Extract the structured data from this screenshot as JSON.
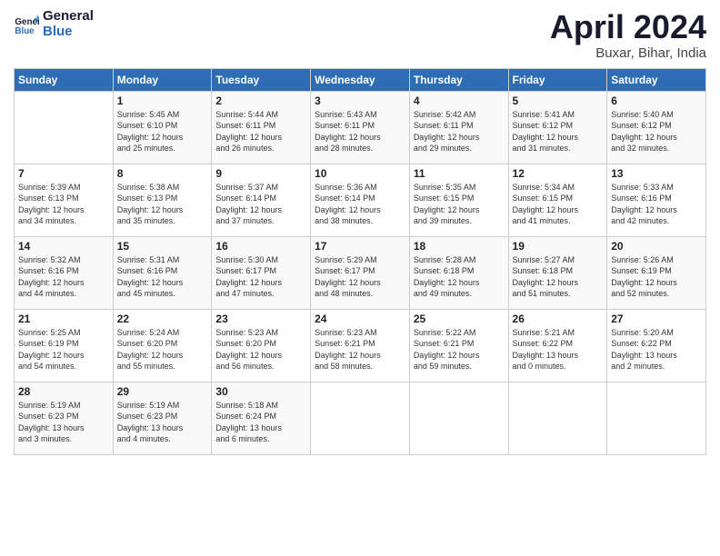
{
  "header": {
    "logo_line1": "General",
    "logo_line2": "Blue",
    "month": "April 2024",
    "location": "Buxar, Bihar, India"
  },
  "days_of_week": [
    "Sunday",
    "Monday",
    "Tuesday",
    "Wednesday",
    "Thursday",
    "Friday",
    "Saturday"
  ],
  "weeks": [
    [
      {
        "day": "",
        "info": ""
      },
      {
        "day": "1",
        "info": "Sunrise: 5:45 AM\nSunset: 6:10 PM\nDaylight: 12 hours\nand 25 minutes."
      },
      {
        "day": "2",
        "info": "Sunrise: 5:44 AM\nSunset: 6:11 PM\nDaylight: 12 hours\nand 26 minutes."
      },
      {
        "day": "3",
        "info": "Sunrise: 5:43 AM\nSunset: 6:11 PM\nDaylight: 12 hours\nand 28 minutes."
      },
      {
        "day": "4",
        "info": "Sunrise: 5:42 AM\nSunset: 6:11 PM\nDaylight: 12 hours\nand 29 minutes."
      },
      {
        "day": "5",
        "info": "Sunrise: 5:41 AM\nSunset: 6:12 PM\nDaylight: 12 hours\nand 31 minutes."
      },
      {
        "day": "6",
        "info": "Sunrise: 5:40 AM\nSunset: 6:12 PM\nDaylight: 12 hours\nand 32 minutes."
      }
    ],
    [
      {
        "day": "7",
        "info": "Sunrise: 5:39 AM\nSunset: 6:13 PM\nDaylight: 12 hours\nand 34 minutes."
      },
      {
        "day": "8",
        "info": "Sunrise: 5:38 AM\nSunset: 6:13 PM\nDaylight: 12 hours\nand 35 minutes."
      },
      {
        "day": "9",
        "info": "Sunrise: 5:37 AM\nSunset: 6:14 PM\nDaylight: 12 hours\nand 37 minutes."
      },
      {
        "day": "10",
        "info": "Sunrise: 5:36 AM\nSunset: 6:14 PM\nDaylight: 12 hours\nand 38 minutes."
      },
      {
        "day": "11",
        "info": "Sunrise: 5:35 AM\nSunset: 6:15 PM\nDaylight: 12 hours\nand 39 minutes."
      },
      {
        "day": "12",
        "info": "Sunrise: 5:34 AM\nSunset: 6:15 PM\nDaylight: 12 hours\nand 41 minutes."
      },
      {
        "day": "13",
        "info": "Sunrise: 5:33 AM\nSunset: 6:16 PM\nDaylight: 12 hours\nand 42 minutes."
      }
    ],
    [
      {
        "day": "14",
        "info": "Sunrise: 5:32 AM\nSunset: 6:16 PM\nDaylight: 12 hours\nand 44 minutes."
      },
      {
        "day": "15",
        "info": "Sunrise: 5:31 AM\nSunset: 6:16 PM\nDaylight: 12 hours\nand 45 minutes."
      },
      {
        "day": "16",
        "info": "Sunrise: 5:30 AM\nSunset: 6:17 PM\nDaylight: 12 hours\nand 47 minutes."
      },
      {
        "day": "17",
        "info": "Sunrise: 5:29 AM\nSunset: 6:17 PM\nDaylight: 12 hours\nand 48 minutes."
      },
      {
        "day": "18",
        "info": "Sunrise: 5:28 AM\nSunset: 6:18 PM\nDaylight: 12 hours\nand 49 minutes."
      },
      {
        "day": "19",
        "info": "Sunrise: 5:27 AM\nSunset: 6:18 PM\nDaylight: 12 hours\nand 51 minutes."
      },
      {
        "day": "20",
        "info": "Sunrise: 5:26 AM\nSunset: 6:19 PM\nDaylight: 12 hours\nand 52 minutes."
      }
    ],
    [
      {
        "day": "21",
        "info": "Sunrise: 5:25 AM\nSunset: 6:19 PM\nDaylight: 12 hours\nand 54 minutes."
      },
      {
        "day": "22",
        "info": "Sunrise: 5:24 AM\nSunset: 6:20 PM\nDaylight: 12 hours\nand 55 minutes."
      },
      {
        "day": "23",
        "info": "Sunrise: 5:23 AM\nSunset: 6:20 PM\nDaylight: 12 hours\nand 56 minutes."
      },
      {
        "day": "24",
        "info": "Sunrise: 5:23 AM\nSunset: 6:21 PM\nDaylight: 12 hours\nand 58 minutes."
      },
      {
        "day": "25",
        "info": "Sunrise: 5:22 AM\nSunset: 6:21 PM\nDaylight: 12 hours\nand 59 minutes."
      },
      {
        "day": "26",
        "info": "Sunrise: 5:21 AM\nSunset: 6:22 PM\nDaylight: 13 hours\nand 0 minutes."
      },
      {
        "day": "27",
        "info": "Sunrise: 5:20 AM\nSunset: 6:22 PM\nDaylight: 13 hours\nand 2 minutes."
      }
    ],
    [
      {
        "day": "28",
        "info": "Sunrise: 5:19 AM\nSunset: 6:23 PM\nDaylight: 13 hours\nand 3 minutes."
      },
      {
        "day": "29",
        "info": "Sunrise: 5:19 AM\nSunset: 6:23 PM\nDaylight: 13 hours\nand 4 minutes."
      },
      {
        "day": "30",
        "info": "Sunrise: 5:18 AM\nSunset: 6:24 PM\nDaylight: 13 hours\nand 6 minutes."
      },
      {
        "day": "",
        "info": ""
      },
      {
        "day": "",
        "info": ""
      },
      {
        "day": "",
        "info": ""
      },
      {
        "day": "",
        "info": ""
      }
    ]
  ]
}
